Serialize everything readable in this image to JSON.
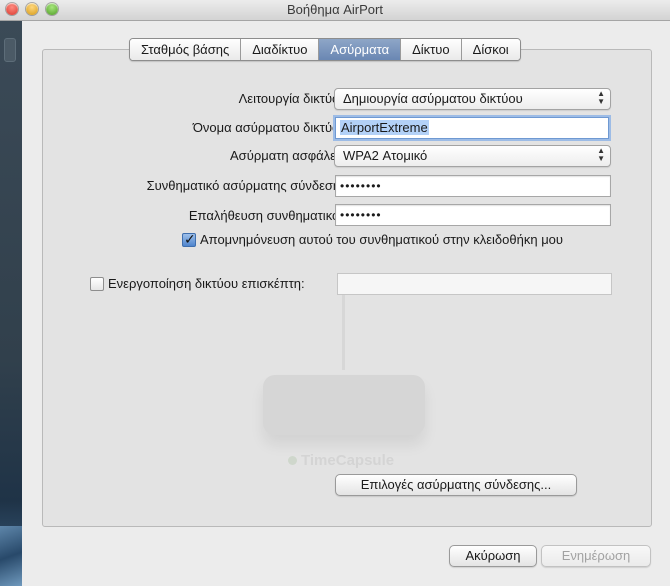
{
  "window": {
    "title": "Βοήθημα AirPort"
  },
  "tabs": [
    {
      "label": "Σταθμός βάσης",
      "selected": false
    },
    {
      "label": "Διαδίκτυο",
      "selected": false
    },
    {
      "label": "Ασύρματα",
      "selected": true
    },
    {
      "label": "Δίκτυο",
      "selected": false
    },
    {
      "label": "Δίσκοι",
      "selected": false
    }
  ],
  "form": {
    "network_mode": {
      "label": "Λειτουργία δικτύου:",
      "value": "Δημιουργία ασύρματου δικτύου"
    },
    "network_name": {
      "label": "Όνομα ασύρματου δικτύου:",
      "value": "AirportExtreme"
    },
    "security": {
      "label": "Ασύρματη ασφάλεια:",
      "value": "WPA2 Ατομικό"
    },
    "password": {
      "label": "Συνθηματικό ασύρματης σύνδεσης:",
      "value": "••••••••"
    },
    "verify": {
      "label": "Επαλήθευση συνθηματικού:",
      "value": "••••••••"
    },
    "remember_keychain": {
      "label": "Απομνημόνευση αυτού του συνθηματικού στην κλειδοθήκη μου",
      "checked": true
    },
    "guest_network": {
      "label": "Ενεργοποίηση δικτύου επισκέπτη:",
      "checked": false,
      "value": ""
    },
    "wireless_options_button": "Επιλογές ασύρματης σύνδεσης..."
  },
  "footer": {
    "cancel": "Ακύρωση",
    "update": "Ενημέρωση"
  },
  "watermark": {
    "device_name": "TimeCapsule"
  },
  "icons": {
    "popup": "updown-arrows-icon",
    "check": "checkmark-icon"
  }
}
